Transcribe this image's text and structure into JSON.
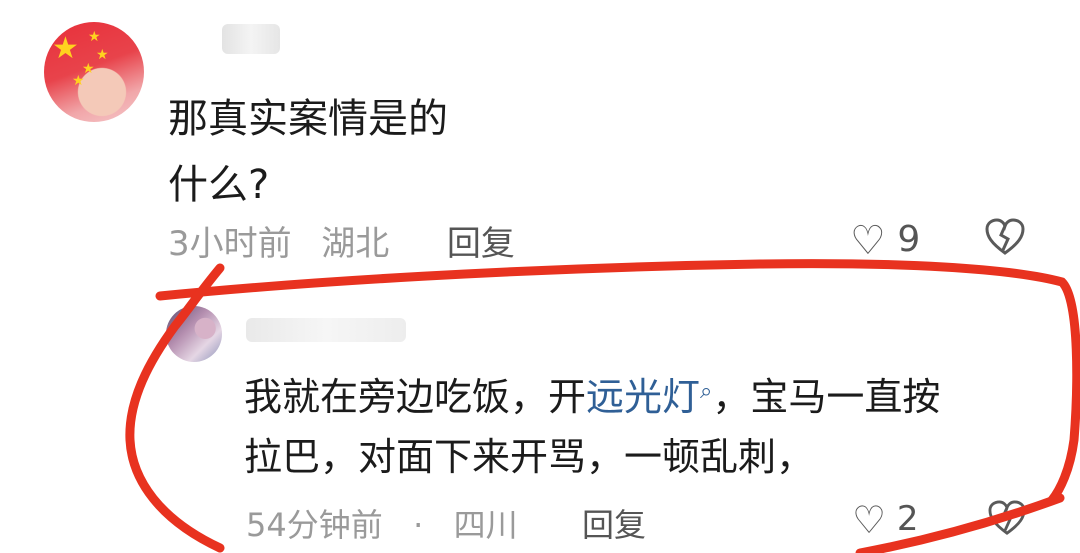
{
  "comment": {
    "text_line1": "那真实案情是的",
    "text_line2": "什么?",
    "time": "3小时前",
    "location": "湖北",
    "reply_label": "回复",
    "like_count": "9",
    "heart_icon": "♡",
    "dislike_icon": "broken-heart-icon"
  },
  "reply": {
    "text_part1": "我就在旁边吃饭，开",
    "link_text": "远光灯",
    "search_icon": "⌕",
    "text_part2": "，宝马一直按",
    "text_line2": "拉巴，对面下来开骂，一顿乱刺，",
    "time": "54分钟前",
    "separator": "·",
    "location": "四川",
    "reply_label": "回复",
    "like_count": "2",
    "heart_icon": "♡"
  },
  "colors": {
    "annotation": "#e8321f",
    "link": "#2f5f96",
    "meta": "#9a9a9a"
  }
}
